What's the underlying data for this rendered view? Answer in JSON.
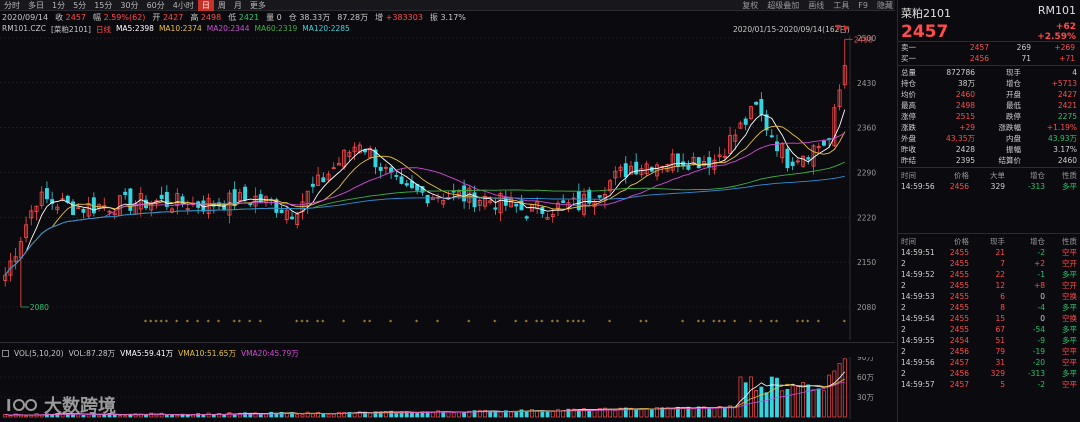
{
  "toolbar": {
    "periods": [
      "分时",
      "多日",
      "1分",
      "5分",
      "15分",
      "30分",
      "60分",
      "4小时",
      "日",
      "周",
      "月",
      "更多"
    ],
    "active_period": "日",
    "right": [
      "复权",
      "超级叠加",
      "画线",
      "工具",
      "F9",
      "隐藏"
    ]
  },
  "info": {
    "date": "2020/09/14",
    "close_label": "收",
    "close": "2457",
    "amp_label": "幅",
    "amp": "2.59%(62)",
    "open_label": "开",
    "open": "2427",
    "high_label": "高",
    "high": "2498",
    "low_label": "低",
    "low": "2421",
    "vol_label": "量",
    "vol": "0",
    "hold_label": "仓",
    "hold": "38.33万",
    "amount": "87.28万",
    "inc_label": "增",
    "inc": "+383303",
    "swing_label": "振",
    "swing": "3.17%"
  },
  "ma": {
    "name": "RM101.CZC",
    "contract": "[菜粕2101]",
    "kline_label": "日线",
    "ma5": "MA5:2398",
    "ma10": "MA10:2374",
    "ma20": "MA20:2344",
    "ma60": "MA60:2319",
    "ma120": "MA120:2285",
    "range": "2020/01/15-2020/09/14(162日)"
  },
  "yaxis": [
    "2500",
    "2430",
    "2360",
    "2290",
    "2220",
    "2150",
    "2080"
  ],
  "marks": {
    "high": "2498",
    "low": "2080"
  },
  "vol": {
    "title": "VOL(5,10,20)",
    "vol": "VOL:87.28万",
    "vma5": "VMA5:59.41万",
    "vma10": "VMA10:51.65万",
    "vma20": "VMA20:45.79万",
    "yaxis": [
      "90万",
      "60万",
      "30万"
    ]
  },
  "logo": "大数跨境",
  "colors": {
    "up": "#ff4b4b",
    "down": "#27c46b",
    "cyan": "#35d4e0",
    "ma5": "#ffffff",
    "ma10": "#e8c23a",
    "ma20": "#d24ad6",
    "ma60": "#3fae43",
    "ma120": "#2f8fd8"
  },
  "panel": {
    "name": "菜粕2101",
    "code": "RM101",
    "price": "2457",
    "change": "+62",
    "pct": "+2.59%",
    "sell1": [
      "卖一",
      "2457",
      "269",
      "+269"
    ],
    "buy1": [
      "买一",
      "2456",
      "71",
      "+71"
    ],
    "stats": [
      [
        "总量",
        "872786",
        "现手",
        "4"
      ],
      [
        "持仓",
        "38万",
        "增仓",
        "+5713"
      ],
      [
        "均价",
        "2460",
        "开盘",
        "2427"
      ],
      [
        "最高",
        "2498",
        "最低",
        "2421"
      ],
      [
        "涨停",
        "2515",
        "跌停",
        "2275"
      ],
      [
        "涨跌",
        "+29",
        "涨跌幅",
        "+1.19%"
      ],
      [
        "外盘",
        "43.35万",
        "内盘",
        "43.93万"
      ],
      [
        "昨收",
        "2428",
        "振幅",
        "3.17%"
      ],
      [
        "昨结",
        "2395",
        "结算价",
        "2460"
      ]
    ],
    "tick_head": [
      "时间",
      "价格",
      "大单",
      "增仓",
      "性质"
    ],
    "tick_top": [
      "14:59:56",
      "2456",
      "329",
      "-313",
      "多平"
    ],
    "trade_head": [
      "时间",
      "价格",
      "现手",
      "增仓",
      "性质"
    ],
    "trades": [
      [
        "14:59:51",
        "2455",
        "21",
        "-2",
        "空平"
      ],
      [
        "2",
        "2455",
        "7",
        "+2",
        "空开"
      ],
      [
        "14:59:52",
        "2455",
        "22",
        "-1",
        "多平"
      ],
      [
        "2",
        "2455",
        "12",
        "+8",
        "空开"
      ],
      [
        "14:59:53",
        "2455",
        "6",
        "0",
        "空换"
      ],
      [
        "2",
        "2455",
        "8",
        "-4",
        "多平"
      ],
      [
        "14:59:54",
        "2455",
        "15",
        "0",
        "空换"
      ],
      [
        "2",
        "2455",
        "67",
        "-54",
        "多平"
      ],
      [
        "14:59:55",
        "2454",
        "51",
        "-9",
        "多平"
      ],
      [
        "2",
        "2456",
        "79",
        "-19",
        "空平"
      ],
      [
        "14:59:56",
        "2457",
        "31",
        "-20",
        "空平"
      ],
      [
        "2",
        "2456",
        "329",
        "-313",
        "多平"
      ],
      [
        "14:59:57",
        "2457",
        "5",
        "-2",
        "空平"
      ]
    ]
  }
}
